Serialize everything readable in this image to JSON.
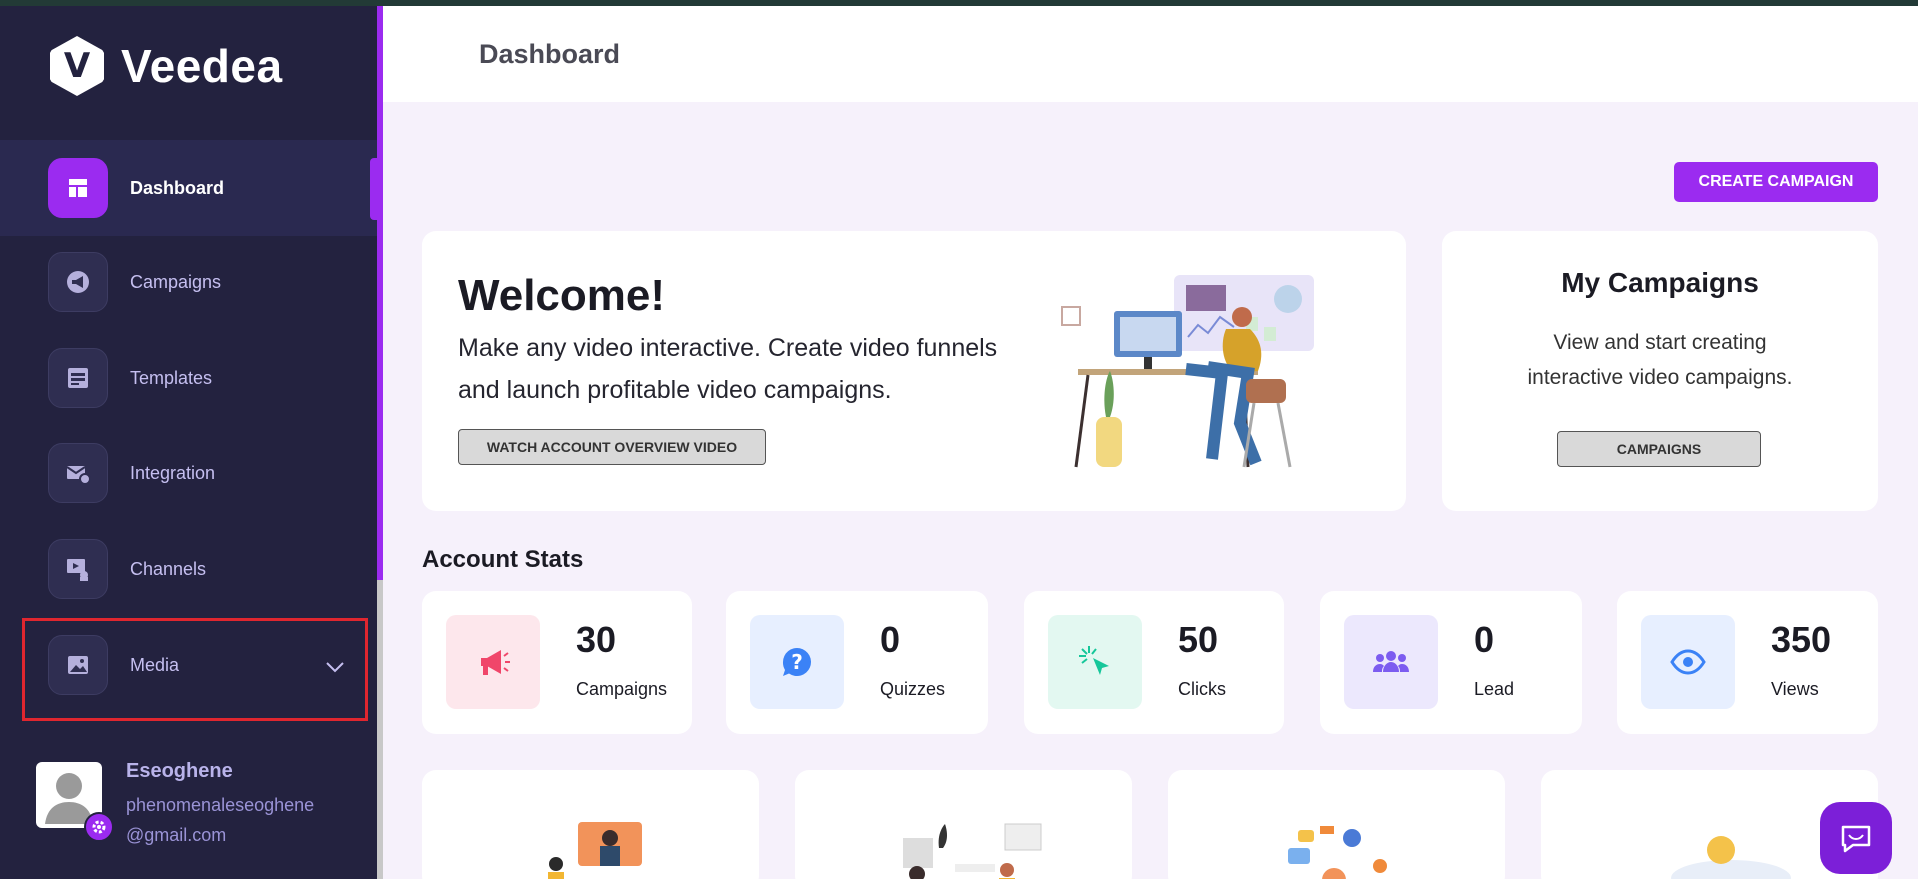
{
  "brand": {
    "name": "Veedea",
    "logo_letter": "V"
  },
  "sidebar": {
    "items": [
      {
        "label": "Dashboard",
        "icon": "dashboard-icon"
      },
      {
        "label": "Campaigns",
        "icon": "megaphone-icon"
      },
      {
        "label": "Templates",
        "icon": "template-icon"
      },
      {
        "label": "Integration",
        "icon": "mail-gear-icon"
      },
      {
        "label": "Channels",
        "icon": "channel-icon"
      },
      {
        "label": "Media",
        "icon": "image-icon"
      }
    ]
  },
  "user": {
    "name": "Eseoghene",
    "email_line1": "phenomenaleseoghene",
    "email_line2": "@gmail.com"
  },
  "header": {
    "title": "Dashboard"
  },
  "actions": {
    "create_campaign": "CREATE CAMPAIGN"
  },
  "welcome": {
    "title": "Welcome!",
    "text": "Make any video interactive. Create video funnels and launch profitable video campaigns.",
    "button": "WATCH ACCOUNT OVERVIEW VIDEO"
  },
  "my_campaigns": {
    "title": "My Campaigns",
    "text": "View and start creating interactive video campaigns.",
    "button": "CAMPAIGNS"
  },
  "stats": {
    "title": "Account Stats",
    "items": [
      {
        "value": "30",
        "label": "Campaigns",
        "color": "#f0466a",
        "bg": "#fde7ec"
      },
      {
        "value": "0",
        "label": "Quizzes",
        "color": "#3b82f6",
        "bg": "#e7efff"
      },
      {
        "value": "50",
        "label": "Clicks",
        "color": "#16c79a",
        "bg": "#e3f8f1"
      },
      {
        "value": "0",
        "label": "Lead",
        "color": "#7c5cf0",
        "bg": "#ece8fd"
      },
      {
        "value": "350",
        "label": "Views",
        "color": "#3b82f6",
        "bg": "#e7efff"
      }
    ]
  },
  "colors": {
    "accent": "#9b2bf0",
    "sidebar_bg": "#23223f",
    "highlight_border": "#e0262f"
  }
}
